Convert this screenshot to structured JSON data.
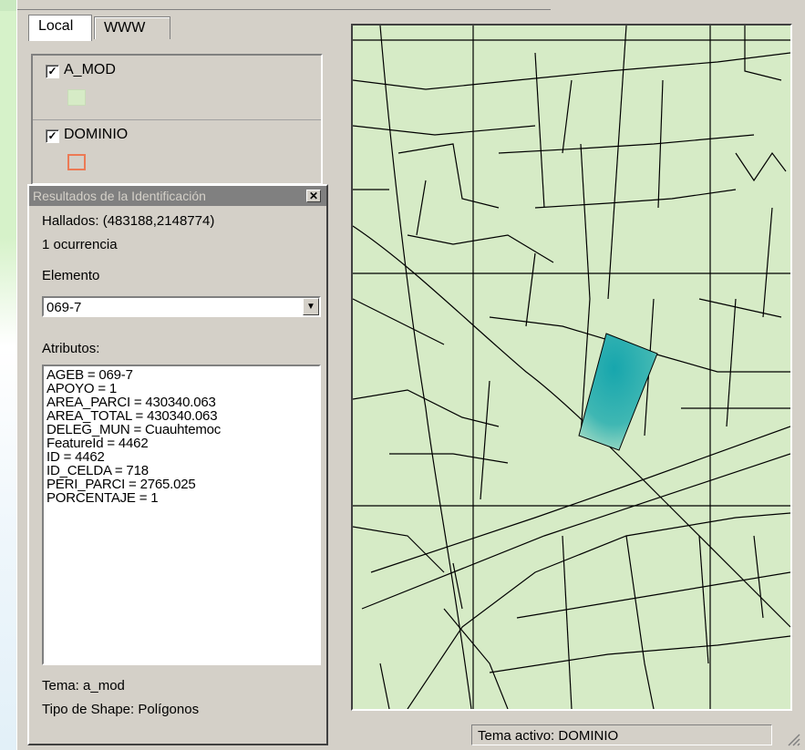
{
  "tabs": [
    {
      "label": "Local",
      "active": true
    },
    {
      "label": "WWW",
      "active": false
    }
  ],
  "layers": [
    {
      "name": "A_MOD",
      "checked": true,
      "symbol": "fill",
      "color": "#d6ebc6"
    },
    {
      "name": "DOMINIO",
      "checked": true,
      "symbol": "outline",
      "color": "#ec7a55"
    }
  ],
  "identify": {
    "title": "Resultados de la Identificación",
    "close_glyph": "✕",
    "found": "Hallados:  (483188,2148774)",
    "occurrences": "1 ocurrencia",
    "element_label": "Elemento",
    "element_value": "069-7",
    "attributes_label": "Atributos:",
    "attributes": [
      "AGEB = 069-7",
      "APOYO = 1",
      "AREA_PARCI = 430340.063",
      "AREA_TOTAL = 430340.063",
      "DELEG_MUN = Cuauhtemoc",
      "FeatureId = 4462",
      "ID = 4462",
      "ID_CELDA = 718",
      "PERI_PARCI = 2765.025",
      "PORCENTAJE = 1"
    ],
    "theme": "Tema:  a_mod",
    "shape_type": "Tipo de Shape:  Polígonos"
  },
  "status": {
    "active_theme": "Tema activo: DOMINIO"
  },
  "colors": {
    "map_fill": "#d6ebc6",
    "highlight": "#1faab0",
    "panel": "#d4d0c8"
  }
}
